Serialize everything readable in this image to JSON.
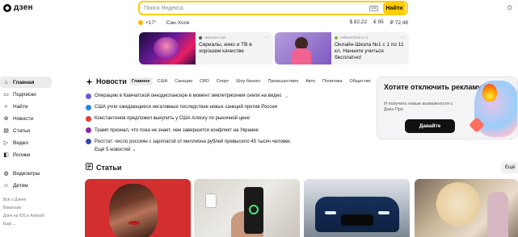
{
  "header": {
    "logo_text": "дзен",
    "search_placeholder": "Поиск Яндекса",
    "search_button": "Найти"
  },
  "infobar": {
    "temperature": "+17°",
    "city": "Сан-Хосе",
    "rates": [
      "$ 82,22",
      "€ 95",
      "₽ 72,48"
    ]
  },
  "promos": [
    {
      "source": "okmovie.com",
      "title": "Сериалы, кино и ТВ в хорошем качестве"
    },
    {
      "source": "onlineschool-1.ru",
      "title": "Онлайн-Школа №1 с 1 по 11 кл. Начните учиться бесплатно!"
    }
  ],
  "sidebar": {
    "items": [
      {
        "label": "Главная",
        "icon": "home-icon"
      },
      {
        "label": "Подписки",
        "icon": "subscriptions-icon"
      },
      {
        "label": "Найти",
        "icon": "search-icon"
      },
      {
        "label": "Новости",
        "icon": "news-icon"
      },
      {
        "label": "Статьи",
        "icon": "articles-icon"
      },
      {
        "label": "Видео",
        "icon": "video-icon"
      },
      {
        "label": "Ролики",
        "icon": "shorts-icon"
      }
    ],
    "items2": [
      {
        "label": "Видеоигры",
        "icon": "gamepad-icon"
      },
      {
        "label": "Детям",
        "icon": "kids-icon"
      }
    ],
    "links": [
      "Всё о Дзене",
      "Вакансии",
      "Дзен на iOS и Android",
      "Ещё"
    ]
  },
  "news": {
    "title": "Новости",
    "tabs": [
      "Главное",
      "США",
      "Санкции",
      "СВО",
      "Спорт",
      "Шоу-бизнес",
      "Происшествия",
      "Авто",
      "Политика",
      "Общество"
    ],
    "items": [
      "Операцию в Камчатской онкодиспансере в момент землетрясения сняли на видео",
      "США учли ожидающиеся негативные последствие новых санкций против России",
      "Константинов предложил выкупить у США Аляску по рыночной цене",
      "Трамп признал, что пока не знает, чем завершится конфликт на Украине",
      "Росстат: число россиян с зарплатой от миллиона рублей превысило 45 тысяч человек"
    ],
    "more": "Ещё 5 новостей"
  },
  "ad": {
    "title": "Хотите отключить рекламу?",
    "subtitle": "И получить новые возможности с Дзен Про",
    "button": "Давайте"
  },
  "articles": {
    "title": "Статьи",
    "more": "Ещё"
  }
}
